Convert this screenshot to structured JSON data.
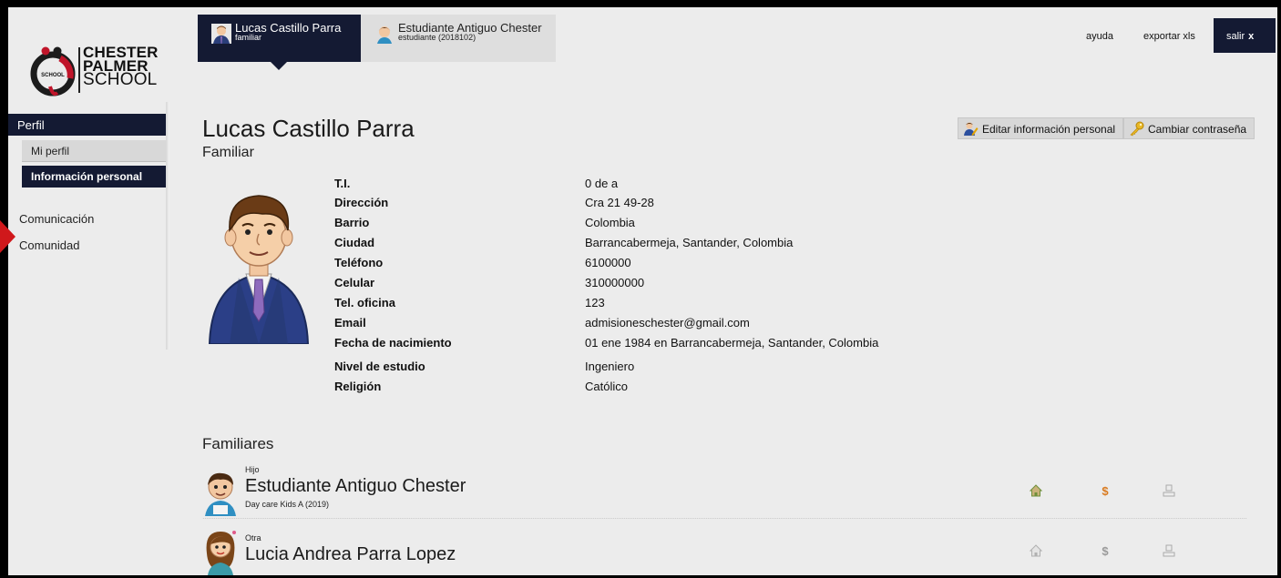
{
  "logo": {
    "line1": "CHESTER",
    "line2": "PALMER",
    "line3": "SCHOOL",
    "badge": "SCHOOL"
  },
  "sidebar": {
    "section": "Perfil",
    "sub_items": [
      "Mi perfil",
      "Información personal"
    ],
    "items": [
      "Comunicación",
      "Comunidad"
    ]
  },
  "tabs": [
    {
      "name": "Lucas Castillo Parra",
      "sub": "familiar"
    },
    {
      "name": "Estudiante Antiguo Chester",
      "sub": "estudiante (2018102)"
    }
  ],
  "top_links": {
    "help": "ayuda",
    "export": "exportar xls",
    "logout": "salir",
    "logout_x": "x"
  },
  "profile": {
    "name": "Lucas Castillo Parra",
    "role": "Familiar",
    "edit_button": "Editar información personal",
    "password_button": "Cambiar contraseña",
    "fields": [
      {
        "label": "T.I.",
        "value": "0 de a"
      },
      {
        "label": "Dirección",
        "value": "Cra 21 49-28"
      },
      {
        "label": "Barrio",
        "value": "Colombia"
      },
      {
        "label": "Ciudad",
        "value": "Barrancabermeja, Santander, Colombia"
      },
      {
        "label": "Teléfono",
        "value": "6100000"
      },
      {
        "label": "Celular",
        "value": "310000000"
      },
      {
        "label": "Tel. oficina",
        "value": "123"
      },
      {
        "label": "Email",
        "value": "admisioneschester@gmail.com"
      },
      {
        "label": "Fecha de nacimiento",
        "value": "01 ene 1984 en Barrancabermeja, Santander, Colombia"
      },
      {
        "label": "Nivel de estudio",
        "value": "Ingeniero"
      },
      {
        "label": "Religión",
        "value": "Católico"
      }
    ]
  },
  "familiares": {
    "title": "Familiares",
    "rows": [
      {
        "relation": "Hijo",
        "name": "Estudiante Antiguo Chester",
        "detail": "Day care Kids A (2019)",
        "icons": [
          "house-icon",
          "dollar-icon",
          "user-icon"
        ]
      },
      {
        "relation": "Otra",
        "name": "Lucia Andrea Parra Lopez",
        "detail": "",
        "icons": [
          "house-icon",
          "dollar-icon",
          "user-icon"
        ]
      }
    ]
  },
  "colors": {
    "navy": "#141a33",
    "panel": "#ececec",
    "alert": "#d0181b"
  }
}
